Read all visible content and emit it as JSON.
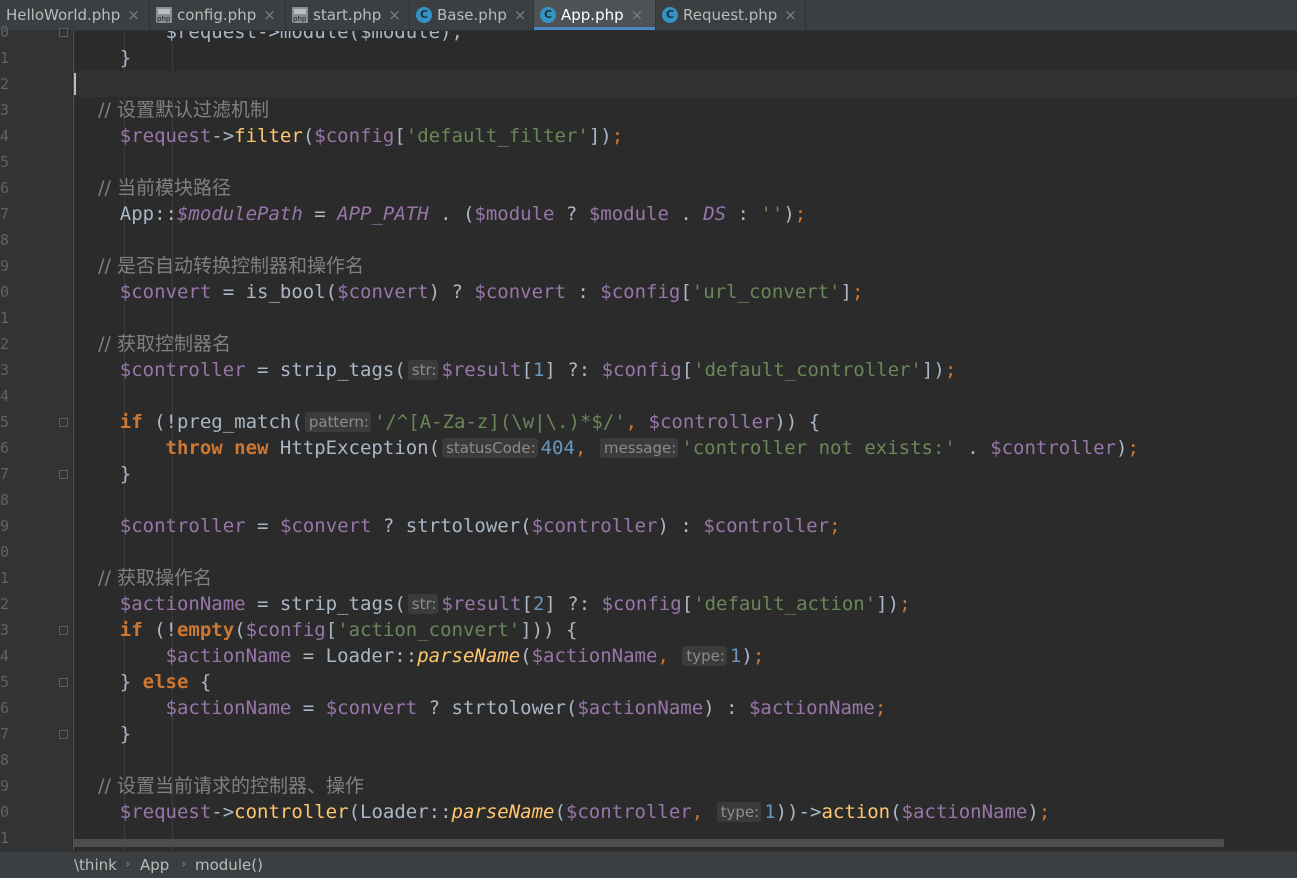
{
  "tabs": [
    {
      "label": "HelloWorld.php",
      "icon": "php-file-icon",
      "active": false
    },
    {
      "label": "config.php",
      "icon": "php-file-icon",
      "active": false
    },
    {
      "label": "start.php",
      "icon": "php-file-icon",
      "active": false
    },
    {
      "label": "Base.php",
      "icon": "php-class-icon",
      "active": false
    },
    {
      "label": "App.php",
      "icon": "php-class-icon",
      "active": true
    },
    {
      "label": "Request.php",
      "icon": "php-class-icon",
      "active": false
    }
  ],
  "tab_close_glyph": "×",
  "editor": {
    "line_numbers": [
      "0",
      "1",
      "2",
      "3",
      "4",
      "5",
      "6",
      "7",
      "8",
      "9",
      "0",
      "1",
      "2",
      "3",
      "4",
      "5",
      "6",
      "7",
      "8",
      "9",
      "0",
      "1",
      "2",
      "3",
      "4",
      "5",
      "6",
      "7",
      "8",
      "9",
      "0",
      "1"
    ],
    "lines": [
      [
        {
          "t": "        $request->module($module);",
          "c": ""
        }
      ],
      [
        {
          "t": "    }",
          "c": ""
        }
      ],
      [],
      [
        {
          "t": "    // 设置默认过滤机制",
          "c": "c"
        }
      ],
      [
        {
          "t": "    ",
          "c": ""
        },
        {
          "t": "$request",
          "c": "v"
        },
        {
          "t": "->",
          "c": ""
        },
        {
          "t": "filter",
          "c": "f"
        },
        {
          "t": "(",
          "c": ""
        },
        {
          "t": "$config",
          "c": "v"
        },
        {
          "t": "[",
          "c": ""
        },
        {
          "t": "'default_filter'",
          "c": "s"
        },
        {
          "t": "])",
          "c": ""
        },
        {
          "t": ";",
          "c": "kp"
        }
      ],
      [],
      [
        {
          "t": "    // 当前模块路径",
          "c": "c"
        }
      ],
      [
        {
          "t": "    App::",
          "c": ""
        },
        {
          "t": "$modulePath",
          "c": "vi"
        },
        {
          "t": " = ",
          "c": ""
        },
        {
          "t": "APP_PATH",
          "c": "ci"
        },
        {
          "t": " . (",
          "c": ""
        },
        {
          "t": "$module",
          "c": "v"
        },
        {
          "t": " ? ",
          "c": ""
        },
        {
          "t": "$module",
          "c": "v"
        },
        {
          "t": " . ",
          "c": ""
        },
        {
          "t": "DS",
          "c": "ci"
        },
        {
          "t": " : ",
          "c": ""
        },
        {
          "t": "''",
          "c": "s"
        },
        {
          "t": ")",
          "c": ""
        },
        {
          "t": ";",
          "c": "kp"
        }
      ],
      [],
      [
        {
          "t": "    // 是否自动转换控制器和操作名",
          "c": "c"
        }
      ],
      [
        {
          "t": "    ",
          "c": ""
        },
        {
          "t": "$convert",
          "c": "v"
        },
        {
          "t": " = is_bool(",
          "c": ""
        },
        {
          "t": "$convert",
          "c": "v"
        },
        {
          "t": ") ? ",
          "c": ""
        },
        {
          "t": "$convert",
          "c": "v"
        },
        {
          "t": " : ",
          "c": ""
        },
        {
          "t": "$config",
          "c": "v"
        },
        {
          "t": "[",
          "c": ""
        },
        {
          "t": "'url_convert'",
          "c": "s"
        },
        {
          "t": "]",
          "c": ""
        },
        {
          "t": ";",
          "c": "kp"
        }
      ],
      [],
      [
        {
          "t": "    // 获取控制器名",
          "c": "c"
        }
      ],
      [
        {
          "t": "    ",
          "c": ""
        },
        {
          "t": "$controller",
          "c": "v"
        },
        {
          "t": " = strip_tags(",
          "c": ""
        },
        {
          "t": "str:",
          "c": "hint"
        },
        {
          "t": "$result",
          "c": "v"
        },
        {
          "t": "[",
          "c": ""
        },
        {
          "t": "1",
          "c": "n"
        },
        {
          "t": "] ?: ",
          "c": ""
        },
        {
          "t": "$config",
          "c": "v"
        },
        {
          "t": "[",
          "c": ""
        },
        {
          "t": "'default_controller'",
          "c": "s"
        },
        {
          "t": "])",
          "c": ""
        },
        {
          "t": ";",
          "c": "kp"
        }
      ],
      [],
      [
        {
          "t": "    ",
          "c": ""
        },
        {
          "t": "if",
          "c": "k"
        },
        {
          "t": " (!preg_match(",
          "c": ""
        },
        {
          "t": "pattern:",
          "c": "hint"
        },
        {
          "t": "'/^[A-Za-z](\\w|\\.)*$/'",
          "c": "s"
        },
        {
          "t": ", ",
          "c": "kp"
        },
        {
          "t": "$controller",
          "c": "v"
        },
        {
          "t": ")) {",
          "c": ""
        }
      ],
      [
        {
          "t": "        ",
          "c": ""
        },
        {
          "t": "throw new",
          "c": "k"
        },
        {
          "t": " HttpException(",
          "c": ""
        },
        {
          "t": "statusCode:",
          "c": "hint"
        },
        {
          "t": "404",
          "c": "n"
        },
        {
          "t": ", ",
          "c": "kp"
        },
        {
          "t": "message:",
          "c": "hint"
        },
        {
          "t": "'controller not exists:'",
          "c": "s"
        },
        {
          "t": " . ",
          "c": ""
        },
        {
          "t": "$controller",
          "c": "v"
        },
        {
          "t": ")",
          "c": ""
        },
        {
          "t": ";",
          "c": "kp"
        }
      ],
      [
        {
          "t": "    }",
          "c": ""
        }
      ],
      [],
      [
        {
          "t": "    ",
          "c": ""
        },
        {
          "t": "$controller",
          "c": "v"
        },
        {
          "t": " = ",
          "c": ""
        },
        {
          "t": "$convert",
          "c": "v"
        },
        {
          "t": " ? strtolower(",
          "c": ""
        },
        {
          "t": "$controller",
          "c": "v"
        },
        {
          "t": ") : ",
          "c": ""
        },
        {
          "t": "$controller",
          "c": "v"
        },
        {
          "t": ";",
          "c": "kp"
        }
      ],
      [],
      [
        {
          "t": "    // 获取操作名",
          "c": "c"
        }
      ],
      [
        {
          "t": "    ",
          "c": ""
        },
        {
          "t": "$actionName",
          "c": "v"
        },
        {
          "t": " = strip_tags(",
          "c": ""
        },
        {
          "t": "str:",
          "c": "hint"
        },
        {
          "t": "$result",
          "c": "v"
        },
        {
          "t": "[",
          "c": ""
        },
        {
          "t": "2",
          "c": "n"
        },
        {
          "t": "] ?: ",
          "c": ""
        },
        {
          "t": "$config",
          "c": "v"
        },
        {
          "t": "[",
          "c": ""
        },
        {
          "t": "'default_action'",
          "c": "s"
        },
        {
          "t": "])",
          "c": ""
        },
        {
          "t": ";",
          "c": "kp"
        }
      ],
      [
        {
          "t": "    ",
          "c": ""
        },
        {
          "t": "if",
          "c": "k"
        },
        {
          "t": " (!",
          "c": ""
        },
        {
          "t": "empty",
          "c": "k"
        },
        {
          "t": "(",
          "c": ""
        },
        {
          "t": "$config",
          "c": "v"
        },
        {
          "t": "[",
          "c": ""
        },
        {
          "t": "'action_convert'",
          "c": "s"
        },
        {
          "t": "])) {",
          "c": ""
        }
      ],
      [
        {
          "t": "        ",
          "c": ""
        },
        {
          "t": "$actionName",
          "c": "v"
        },
        {
          "t": " = Loader::",
          "c": ""
        },
        {
          "t": "parseName",
          "c": "fi"
        },
        {
          "t": "(",
          "c": ""
        },
        {
          "t": "$actionName",
          "c": "v"
        },
        {
          "t": ", ",
          "c": "kp"
        },
        {
          "t": "type:",
          "c": "hint"
        },
        {
          "t": "1",
          "c": "n"
        },
        {
          "t": ")",
          "c": ""
        },
        {
          "t": ";",
          "c": "kp"
        }
      ],
      [
        {
          "t": "    } ",
          "c": ""
        },
        {
          "t": "else",
          "c": "k"
        },
        {
          "t": " {",
          "c": ""
        }
      ],
      [
        {
          "t": "        ",
          "c": ""
        },
        {
          "t": "$actionName",
          "c": "v"
        },
        {
          "t": " = ",
          "c": ""
        },
        {
          "t": "$convert",
          "c": "v"
        },
        {
          "t": " ? strtolower(",
          "c": ""
        },
        {
          "t": "$actionName",
          "c": "v"
        },
        {
          "t": ") : ",
          "c": ""
        },
        {
          "t": "$actionName",
          "c": "v"
        },
        {
          "t": ";",
          "c": "kp"
        }
      ],
      [
        {
          "t": "    }",
          "c": ""
        }
      ],
      [],
      [
        {
          "t": "    // 设置当前请求的控制器、操作",
          "c": "c"
        }
      ],
      [
        {
          "t": "    ",
          "c": ""
        },
        {
          "t": "$request",
          "c": "v"
        },
        {
          "t": "->",
          "c": ""
        },
        {
          "t": "controller",
          "c": "f"
        },
        {
          "t": "(Loader::",
          "c": ""
        },
        {
          "t": "parseName",
          "c": "fi"
        },
        {
          "t": "(",
          "c": ""
        },
        {
          "t": "$controller",
          "c": "v"
        },
        {
          "t": ", ",
          "c": "kp"
        },
        {
          "t": "type:",
          "c": "hint"
        },
        {
          "t": "1",
          "c": "n"
        },
        {
          "t": "))->",
          "c": ""
        },
        {
          "t": "action",
          "c": "f"
        },
        {
          "t": "(",
          "c": ""
        },
        {
          "t": "$actionName",
          "c": "v"
        },
        {
          "t": ")",
          "c": ""
        },
        {
          "t": ";",
          "c": "kp"
        }
      ],
      []
    ],
    "current_line_index": 2,
    "fold_markers": [
      0,
      15,
      17,
      23,
      25,
      27
    ]
  },
  "breadcrumb": [
    "\\think",
    "App",
    "module()"
  ],
  "breadcrumb_separator": "›",
  "colors": {
    "editor_bg": "#2b2b2b",
    "gutter_bg": "#313335",
    "comment": "#808080",
    "keyword": "#cc7832",
    "variable": "#9876aa",
    "string": "#6a8759",
    "number": "#6897bb",
    "function": "#ffc66d",
    "active_tab_accent": "#4a88c7"
  }
}
